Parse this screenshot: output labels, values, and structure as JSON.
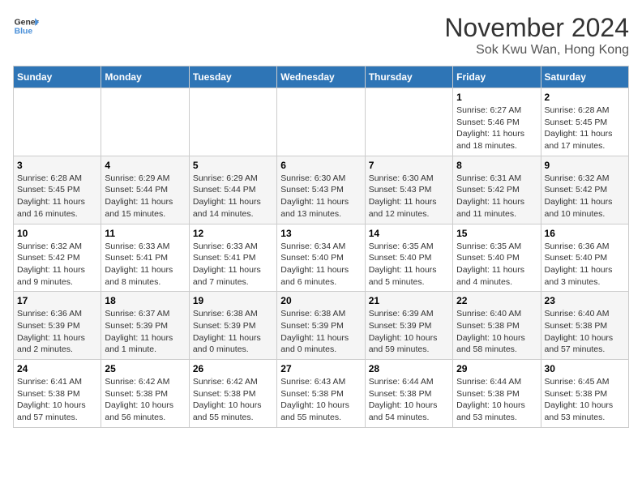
{
  "header": {
    "logo_line1": "General",
    "logo_line2": "Blue",
    "month_title": "November 2024",
    "location": "Sok Kwu Wan, Hong Kong"
  },
  "days_of_week": [
    "Sunday",
    "Monday",
    "Tuesday",
    "Wednesday",
    "Thursday",
    "Friday",
    "Saturday"
  ],
  "weeks": [
    [
      {
        "day": "",
        "info": ""
      },
      {
        "day": "",
        "info": ""
      },
      {
        "day": "",
        "info": ""
      },
      {
        "day": "",
        "info": ""
      },
      {
        "day": "",
        "info": ""
      },
      {
        "day": "1",
        "info": "Sunrise: 6:27 AM\nSunset: 5:46 PM\nDaylight: 11 hours and 18 minutes."
      },
      {
        "day": "2",
        "info": "Sunrise: 6:28 AM\nSunset: 5:45 PM\nDaylight: 11 hours and 17 minutes."
      }
    ],
    [
      {
        "day": "3",
        "info": "Sunrise: 6:28 AM\nSunset: 5:45 PM\nDaylight: 11 hours and 16 minutes."
      },
      {
        "day": "4",
        "info": "Sunrise: 6:29 AM\nSunset: 5:44 PM\nDaylight: 11 hours and 15 minutes."
      },
      {
        "day": "5",
        "info": "Sunrise: 6:29 AM\nSunset: 5:44 PM\nDaylight: 11 hours and 14 minutes."
      },
      {
        "day": "6",
        "info": "Sunrise: 6:30 AM\nSunset: 5:43 PM\nDaylight: 11 hours and 13 minutes."
      },
      {
        "day": "7",
        "info": "Sunrise: 6:30 AM\nSunset: 5:43 PM\nDaylight: 11 hours and 12 minutes."
      },
      {
        "day": "8",
        "info": "Sunrise: 6:31 AM\nSunset: 5:42 PM\nDaylight: 11 hours and 11 minutes."
      },
      {
        "day": "9",
        "info": "Sunrise: 6:32 AM\nSunset: 5:42 PM\nDaylight: 11 hours and 10 minutes."
      }
    ],
    [
      {
        "day": "10",
        "info": "Sunrise: 6:32 AM\nSunset: 5:42 PM\nDaylight: 11 hours and 9 minutes."
      },
      {
        "day": "11",
        "info": "Sunrise: 6:33 AM\nSunset: 5:41 PM\nDaylight: 11 hours and 8 minutes."
      },
      {
        "day": "12",
        "info": "Sunrise: 6:33 AM\nSunset: 5:41 PM\nDaylight: 11 hours and 7 minutes."
      },
      {
        "day": "13",
        "info": "Sunrise: 6:34 AM\nSunset: 5:40 PM\nDaylight: 11 hours and 6 minutes."
      },
      {
        "day": "14",
        "info": "Sunrise: 6:35 AM\nSunset: 5:40 PM\nDaylight: 11 hours and 5 minutes."
      },
      {
        "day": "15",
        "info": "Sunrise: 6:35 AM\nSunset: 5:40 PM\nDaylight: 11 hours and 4 minutes."
      },
      {
        "day": "16",
        "info": "Sunrise: 6:36 AM\nSunset: 5:40 PM\nDaylight: 11 hours and 3 minutes."
      }
    ],
    [
      {
        "day": "17",
        "info": "Sunrise: 6:36 AM\nSunset: 5:39 PM\nDaylight: 11 hours and 2 minutes."
      },
      {
        "day": "18",
        "info": "Sunrise: 6:37 AM\nSunset: 5:39 PM\nDaylight: 11 hours and 1 minute."
      },
      {
        "day": "19",
        "info": "Sunrise: 6:38 AM\nSunset: 5:39 PM\nDaylight: 11 hours and 0 minutes."
      },
      {
        "day": "20",
        "info": "Sunrise: 6:38 AM\nSunset: 5:39 PM\nDaylight: 11 hours and 0 minutes."
      },
      {
        "day": "21",
        "info": "Sunrise: 6:39 AM\nSunset: 5:39 PM\nDaylight: 10 hours and 59 minutes."
      },
      {
        "day": "22",
        "info": "Sunrise: 6:40 AM\nSunset: 5:38 PM\nDaylight: 10 hours and 58 minutes."
      },
      {
        "day": "23",
        "info": "Sunrise: 6:40 AM\nSunset: 5:38 PM\nDaylight: 10 hours and 57 minutes."
      }
    ],
    [
      {
        "day": "24",
        "info": "Sunrise: 6:41 AM\nSunset: 5:38 PM\nDaylight: 10 hours and 57 minutes."
      },
      {
        "day": "25",
        "info": "Sunrise: 6:42 AM\nSunset: 5:38 PM\nDaylight: 10 hours and 56 minutes."
      },
      {
        "day": "26",
        "info": "Sunrise: 6:42 AM\nSunset: 5:38 PM\nDaylight: 10 hours and 55 minutes."
      },
      {
        "day": "27",
        "info": "Sunrise: 6:43 AM\nSunset: 5:38 PM\nDaylight: 10 hours and 55 minutes."
      },
      {
        "day": "28",
        "info": "Sunrise: 6:44 AM\nSunset: 5:38 PM\nDaylight: 10 hours and 54 minutes."
      },
      {
        "day": "29",
        "info": "Sunrise: 6:44 AM\nSunset: 5:38 PM\nDaylight: 10 hours and 53 minutes."
      },
      {
        "day": "30",
        "info": "Sunrise: 6:45 AM\nSunset: 5:38 PM\nDaylight: 10 hours and 53 minutes."
      }
    ]
  ]
}
